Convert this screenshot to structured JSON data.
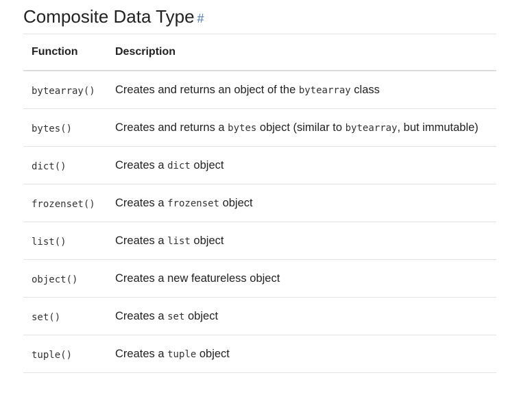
{
  "heading": {
    "title": "Composite Data Type",
    "anchor": "#"
  },
  "table": {
    "headers": {
      "function": "Function",
      "description": "Description"
    },
    "rows": [
      {
        "function": "bytearray()",
        "description": [
          {
            "text": "Creates and returns an object of the "
          },
          {
            "code": "bytearray"
          },
          {
            "text": " class"
          }
        ]
      },
      {
        "function": "bytes()",
        "description": [
          {
            "text": "Creates and returns a "
          },
          {
            "code": "bytes"
          },
          {
            "text": " object (similar to "
          },
          {
            "code": "bytearray"
          },
          {
            "text": ", but immutable)"
          }
        ]
      },
      {
        "function": "dict()",
        "description": [
          {
            "text": "Creates a "
          },
          {
            "code": "dict"
          },
          {
            "text": " object"
          }
        ]
      },
      {
        "function": "frozenset()",
        "description": [
          {
            "text": "Creates a "
          },
          {
            "code": "frozenset"
          },
          {
            "text": " object"
          }
        ]
      },
      {
        "function": "list()",
        "description": [
          {
            "text": "Creates a "
          },
          {
            "code": "list"
          },
          {
            "text": " object"
          }
        ]
      },
      {
        "function": "object()",
        "description": [
          {
            "text": "Creates a new featureless object"
          }
        ]
      },
      {
        "function": "set()",
        "description": [
          {
            "text": "Creates a "
          },
          {
            "code": "set"
          },
          {
            "text": " object"
          }
        ]
      },
      {
        "function": "tuple()",
        "description": [
          {
            "text": "Creates a "
          },
          {
            "code": "tuple"
          },
          {
            "text": " object"
          }
        ]
      }
    ]
  }
}
